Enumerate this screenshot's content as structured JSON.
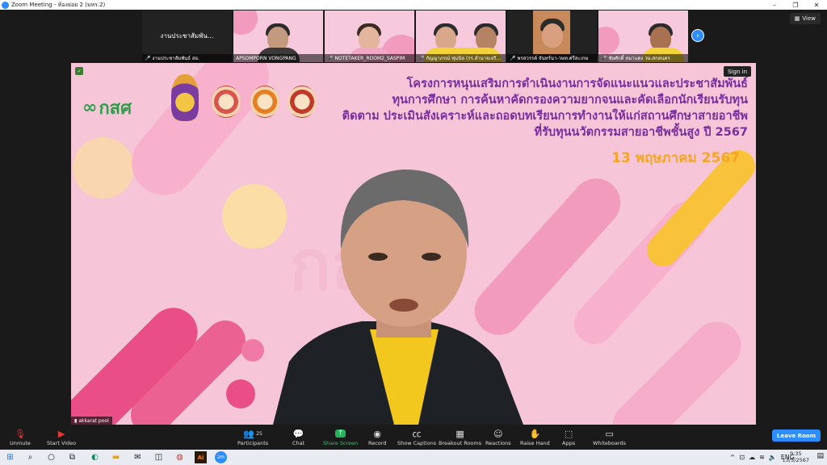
{
  "window": {
    "title": "Zoom Meeting - ห้องย่อย 2 (มหร.2)",
    "controls": [
      "–",
      "❐",
      "✕"
    ]
  },
  "view_button": "View",
  "thumbnails": [
    {
      "name": "งานประชาสัมพันธ์ สอ.",
      "center_text": "งานประชาสัมพัน...",
      "muted": true,
      "dark": true
    },
    {
      "name": "APSOMPORN VONGPANG",
      "muted": false,
      "dark": false
    },
    {
      "name": "NOTETAKER_ROOM2_SASPIM",
      "muted": true,
      "dark": false
    },
    {
      "name": "กัญญาภรณ์ ทุ่มนิล (รร.อำนาจเจริ...",
      "muted": true,
      "dark": false
    },
    {
      "name": "พรสวรรค์ จันทร์นา-วษท.ศรีสะเกษ",
      "muted": true,
      "dark": false
    },
    {
      "name": "ชัยศักดิ์ หมาแดง วษ.สกลนคร",
      "muted": true,
      "dark": false
    }
  ],
  "main": {
    "sign_in": "Sign in",
    "logo_text": "กสศ",
    "headline": [
      "โครงการหนุนเสริมการดำเนินงานการจัดแนะแนวและประชาสัมพันธ์",
      "ทุนการศึกษา การค้นหาคัดกรองความยากจนและคัดเลือกนักเรียนรับทุน",
      "ติดตาม ประเมินสังเคราะห์และถอดบทเรียนการทำงานให้แก่สถานศึกษาสายอาชีพ",
      "ที่รับทุนนวัตกรรมสายอาชีพชั้นสูง ปี 2567"
    ],
    "date": "13 พฤษภาคม 2567",
    "watermark": "กสศ",
    "nametag": "akkarat pool"
  },
  "toolbar": {
    "unmute": "Unmute",
    "start_video": "Start Video",
    "participants": "Participants",
    "participants_count": "25",
    "chat": "Chat",
    "share_screen": "Share Screen",
    "record": "Record",
    "show_captions": "Show Captions",
    "breakout_rooms": "Breakout Rooms",
    "reactions": "Reactions",
    "raise_hand": "Raise Hand",
    "apps": "Apps",
    "whiteboards": "Whiteboards",
    "leave_room": "Leave Room"
  },
  "taskbar": {
    "time": "9:35",
    "date": "13/5/2567",
    "lang": "ENG"
  },
  "colors": {
    "accent": "#2d8cff",
    "headline": "#7a2e9e",
    "date": "#f5a623",
    "bg_pink": "#f6c6d8",
    "share_green": "#25b25b"
  }
}
